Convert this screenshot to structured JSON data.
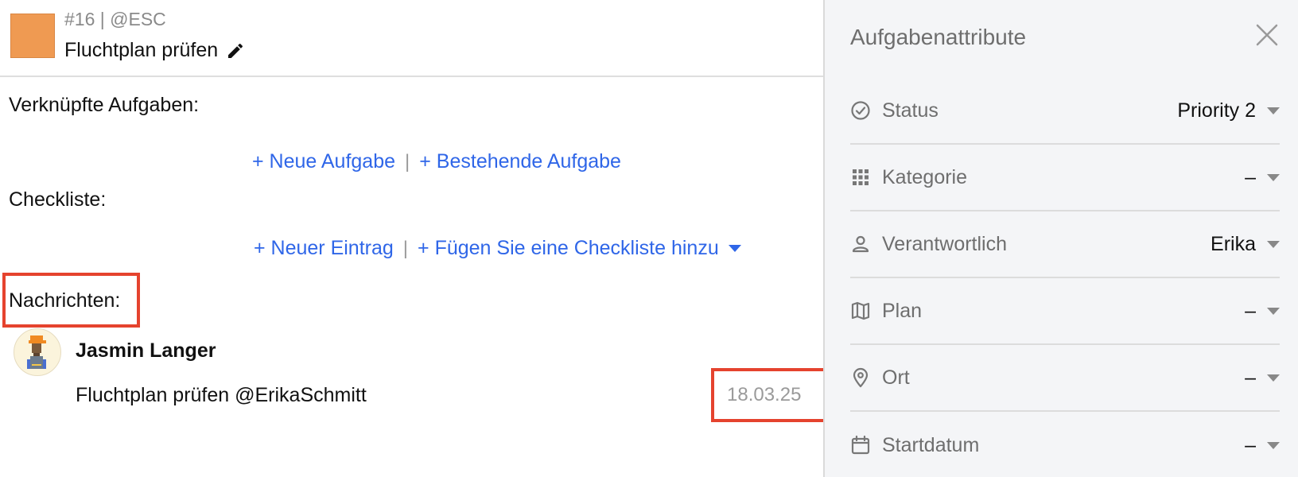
{
  "task": {
    "meta": "#16 | @ESC",
    "title": "Fluchtplan prüfen",
    "color": "#ef9a52"
  },
  "sections": {
    "linked_label": "Verknüpfte Aufgaben:",
    "checklist_label": "Checkliste:",
    "messages_label": "Nachrichten:"
  },
  "linked_actions": {
    "new_task": "+ Neue Aufgabe",
    "separator": "|",
    "existing_task": "+ Bestehende Aufgabe"
  },
  "checklist_actions": {
    "new_entry": "+ Neuer Eintrag",
    "separator": "|",
    "add_checklist": "+ Fügen Sie eine Checkliste hinzu"
  },
  "messages": [
    {
      "author": "Jasmin Langer",
      "text": "Fluchtplan prüfen @ErikaSchmitt",
      "date": "18.03.25"
    }
  ],
  "panel": {
    "title": "Aufgabenattribute",
    "attributes": [
      {
        "label": "Status",
        "value": "Priority 2",
        "icon": "check-circle-icon"
      },
      {
        "label": "Kategorie",
        "value": "–",
        "icon": "grid-icon"
      },
      {
        "label": "Verantwortlich",
        "value": "Erika",
        "icon": "person-icon"
      },
      {
        "label": "Plan",
        "value": "–",
        "icon": "map-icon"
      },
      {
        "label": "Ort",
        "value": "–",
        "icon": "location-pin-icon"
      },
      {
        "label": "Startdatum",
        "value": "–",
        "icon": "calendar-icon"
      }
    ]
  },
  "colors": {
    "link": "#2f66e8",
    "highlight": "#e5432e",
    "panel_bg": "#f4f5f7"
  }
}
